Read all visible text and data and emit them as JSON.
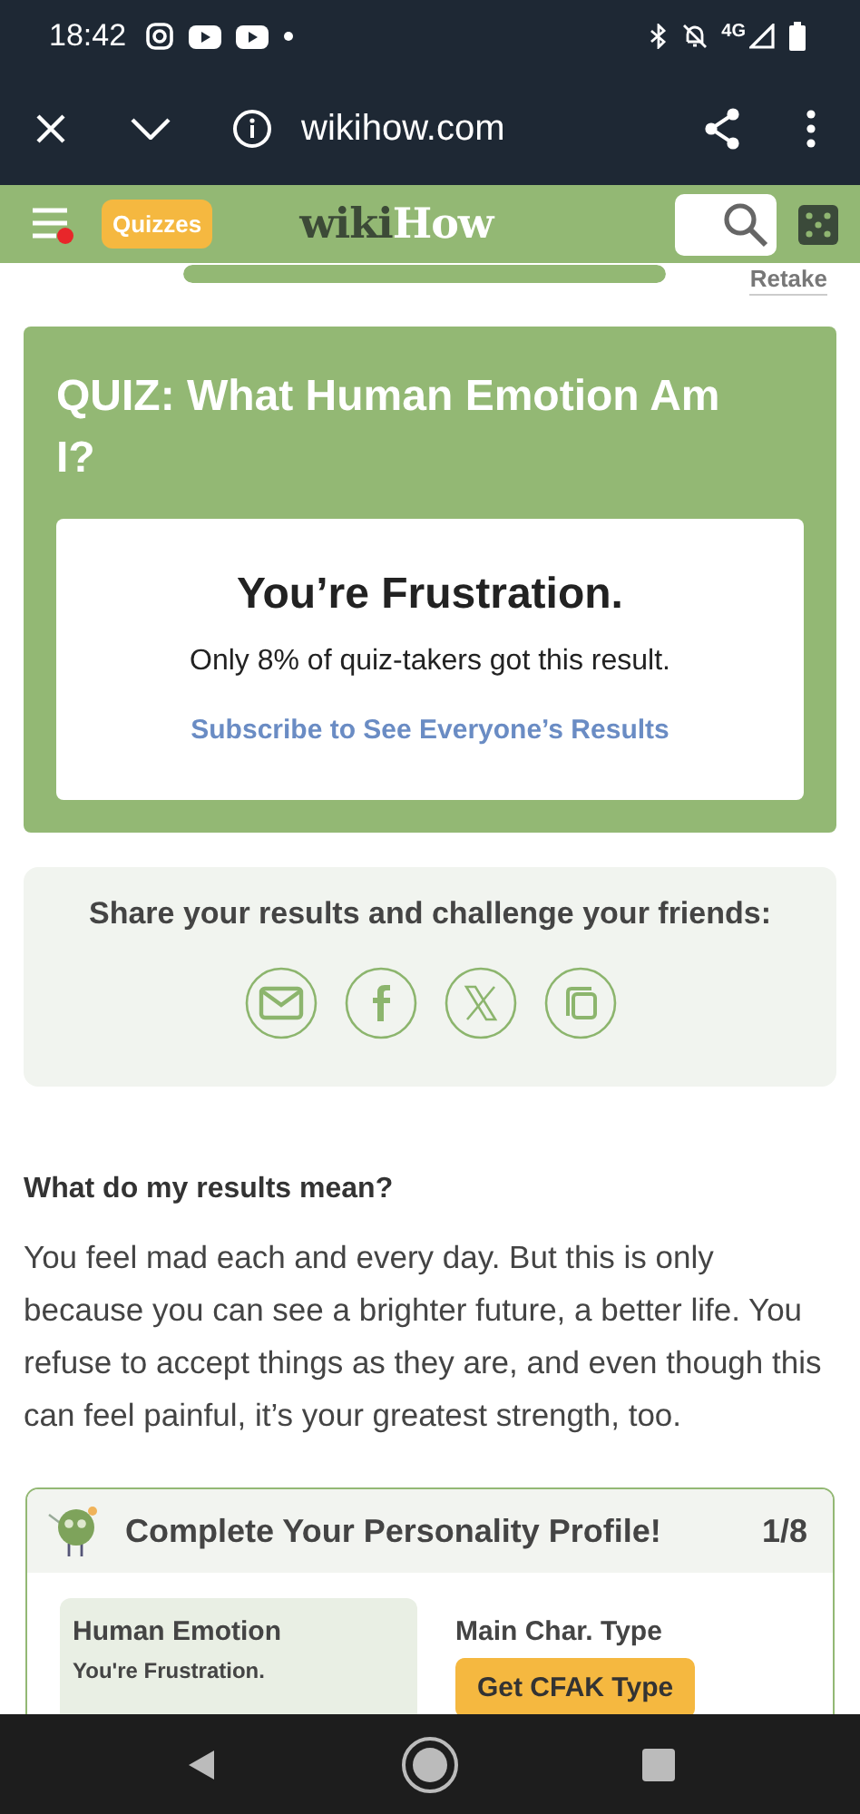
{
  "status_bar": {
    "time": "18:42",
    "network": "4G"
  },
  "browser": {
    "url": "wikihow.com"
  },
  "header": {
    "menu_badge": true,
    "quizzes": "Quizzes",
    "logo_left": "wiki",
    "logo_right": "How"
  },
  "progress": {
    "level": 1,
    "retake": "Retake"
  },
  "quiz": {
    "title": "QUIZ: What Human Emotion Am I?",
    "result": "You’re Frustration.",
    "stat": "Only 8% of quiz-takers got this result.",
    "link": "Subscribe to See Everyone’s Results"
  },
  "share": {
    "heading": "Share your results and challenge your friends:",
    "buttons": [
      {
        "kind": "email"
      },
      {
        "kind": "facebook"
      },
      {
        "kind": "x"
      },
      {
        "kind": "copy"
      }
    ]
  },
  "meaning": {
    "heading": "What do my results mean?",
    "text": "You feel mad each and every day. But this is only because you can see a brighter future, a better life. You refuse to accept things as they are, and even though this can feel painful, it’s your greatest strength, too."
  },
  "profile": {
    "title": "Complete Your Personality Profile!",
    "count": "1/8",
    "items": [
      {
        "kind": "result",
        "title": "Human Emotion",
        "detail": "You're Frustration."
      },
      {
        "kind": "action",
        "title": "Main Char. Type",
        "button": "Get CFAK Type"
      }
    ]
  }
}
